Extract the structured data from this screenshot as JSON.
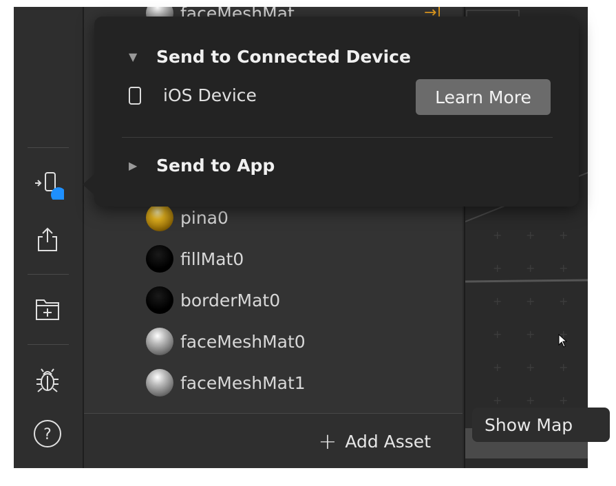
{
  "assets": {
    "top_partial": "faceMeshMat",
    "items": [
      {
        "label": "pina0",
        "sphere": "gold"
      },
      {
        "label": "fillMat0",
        "sphere": "black"
      },
      {
        "label": "borderMat0",
        "sphere": "black"
      },
      {
        "label": "faceMeshMat0",
        "sphere": "silver"
      },
      {
        "label": "faceMeshMat1",
        "sphere": "silver"
      }
    ],
    "add_asset_label": "Add Asset"
  },
  "popover": {
    "section_connected": "Send to Connected Device",
    "device_label": "iOS Device",
    "learn_more": "Learn More",
    "section_app": "Send to App"
  },
  "canvas": {
    "show_map_label": "Show Map"
  },
  "rail": {
    "icons": [
      "send-to-device-icon",
      "share-icon",
      "add-folder-icon",
      "bug-icon",
      "help-icon"
    ]
  },
  "colors": {
    "accent_blue": "#1e90ff",
    "popover_bg": "#232323",
    "button_bg": "#6b6b6b"
  }
}
